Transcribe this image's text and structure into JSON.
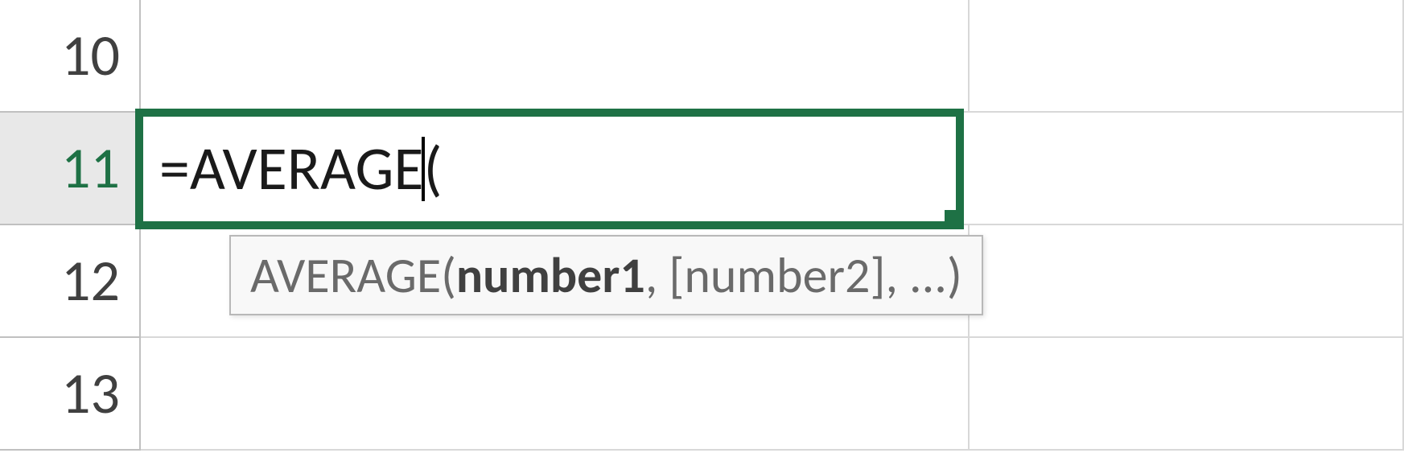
{
  "rows": {
    "r10": {
      "label": "10"
    },
    "r11": {
      "label": "11",
      "formula": "=AVERAGE("
    },
    "r12": {
      "label": "12"
    },
    "r13": {
      "label": "13"
    }
  },
  "tooltip": {
    "func_name": "AVERAGE(",
    "arg1": "number1",
    "sep1": ", ",
    "arg2": "[number2]",
    "rest": ", ...)"
  },
  "colors": {
    "selection_border": "#1e7145",
    "active_header_text": "#1e7145",
    "grid_line": "#d8d8d8",
    "header_border": "#c0c0c0"
  }
}
